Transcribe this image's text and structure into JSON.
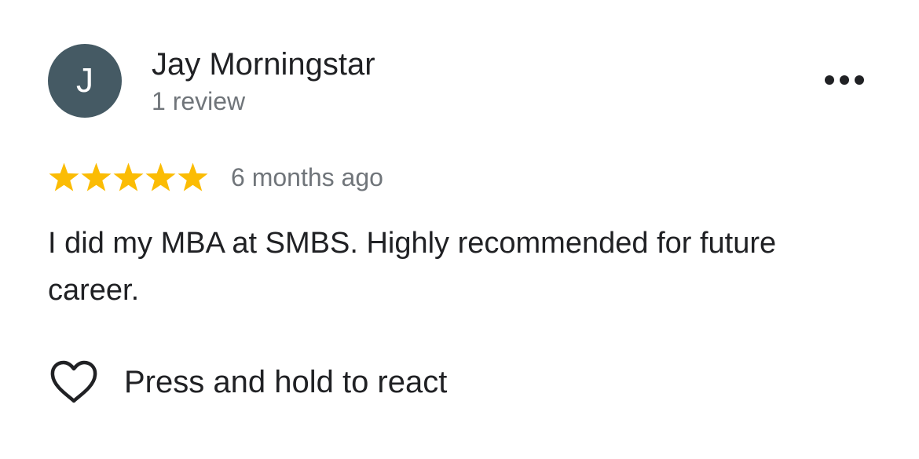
{
  "review": {
    "avatar_initial": "J",
    "author_name": "Jay Morningstar",
    "review_count": "1 review",
    "rating": 5,
    "rating_max": 5,
    "timestamp": "6 months ago",
    "text": "I did my MBA at SMBS. Highly recommended for future career."
  },
  "actions": {
    "react_label": "Press and hold to react",
    "more_icon": "more-horizontal-icon",
    "react_icon": "heart-outline-icon"
  },
  "colors": {
    "avatar_bg": "#455a64",
    "star": "#fbbc04",
    "secondary_text": "#70757a",
    "primary_text": "#202124"
  }
}
